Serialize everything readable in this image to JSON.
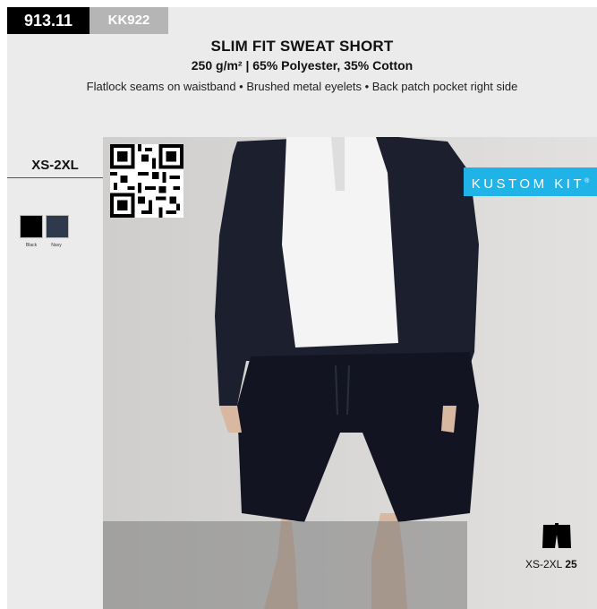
{
  "product": {
    "code": "913.11",
    "ref": "KK922",
    "title": "SLIM FIT SWEAT SHORT",
    "subtitle": "250 g/m² | 65% Polyester, 35% Cotton",
    "features": "Flatlock seams on waistband • Brushed metal eyelets • Back patch pocket right side"
  },
  "sizes": "XS-2XL",
  "colors": [
    {
      "name": "Black",
      "hex": "#000000"
    },
    {
      "name": "Navy",
      "hex": "#2e3a4b"
    }
  ],
  "brand": {
    "logo_text": "KUSTOM KIT",
    "logo_mark": "®",
    "logo_color": "#1fb3e8"
  },
  "pack": {
    "size_label": "XS-2XL",
    "quantity": "25"
  },
  "icons": [
    "qr-code-icon",
    "short-garment-icon"
  ]
}
